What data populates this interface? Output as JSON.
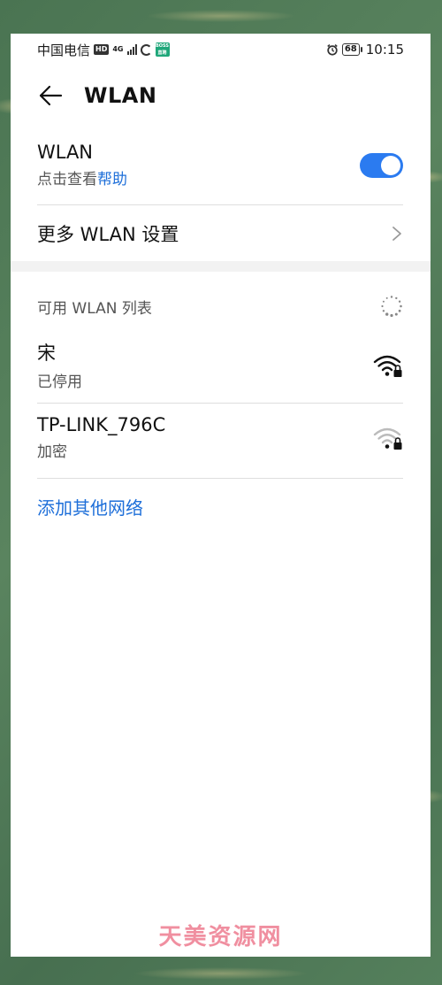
{
  "status_bar": {
    "carrier": "中国电信",
    "hd_badge": "HD",
    "network_type": "4G",
    "app_badge": "BOSS\n直聘",
    "battery_level": "68",
    "time": "10:15"
  },
  "header": {
    "title": "WLAN"
  },
  "wlan_toggle": {
    "label": "WLAN",
    "sub_prefix": "点击查看",
    "sub_link": "帮助",
    "enabled": true
  },
  "more_settings": {
    "label": "更多 WLAN 设置"
  },
  "available_list": {
    "title": "可用 WLAN 列表",
    "networks": [
      {
        "ssid": "宋",
        "status": "已停用",
        "signal": "strong",
        "locked": true
      },
      {
        "ssid": "TP-LINK_796C",
        "status": "加密",
        "signal": "weak",
        "locked": true
      }
    ],
    "add_label": "添加其他网络"
  },
  "watermark": "天美资源网",
  "colors": {
    "accent": "#2b7bf0",
    "link": "#1e6fd9",
    "background_frame": "#4f7a57"
  }
}
